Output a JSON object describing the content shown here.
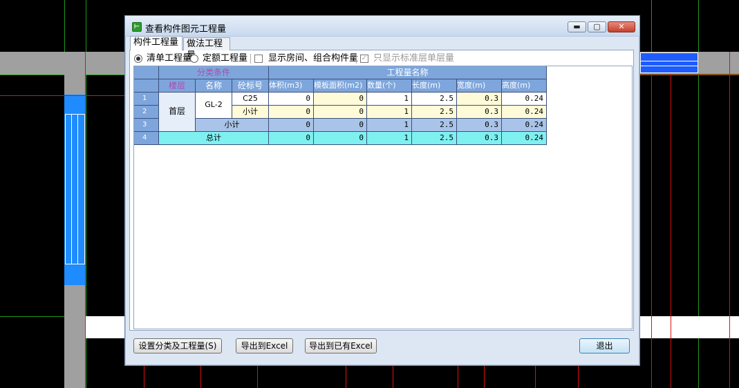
{
  "window": {
    "title": "查看构件图元工程量",
    "minimize_glyph": "▬",
    "maximize_glyph": "▢",
    "close_glyph": "✕"
  },
  "tabs": [
    {
      "label": "构件工程量",
      "active": true
    },
    {
      "label": "做法工程量",
      "active": false
    }
  ],
  "options": {
    "radio_bill": "清单工程量",
    "radio_quota": "定额工程量",
    "check_show_rooms": "显示房间、组合构件量",
    "check_standard_floor": "只显示标准层单层量",
    "check_standard_floor_mark": "✓"
  },
  "table": {
    "group_header_classify": "分类条件",
    "group_header_quantity": "工程量名称",
    "columns": [
      "楼层",
      "名称",
      "砼标号",
      "体积(m3)",
      "模板面积(m2)",
      "数量(个)",
      "长度(m)",
      "宽度(m)",
      "高度(m)"
    ],
    "row_numbers": [
      "1",
      "2",
      "3",
      "4"
    ],
    "floor": "首层",
    "name": "GL-2",
    "rows": [
      {
        "grade": "C25",
        "volume": "0",
        "formwork": "0",
        "count": "1",
        "length": "2.5",
        "width": "0.3",
        "height": "0.24"
      },
      {
        "grade": "小计",
        "volume": "0",
        "formwork": "0",
        "count": "1",
        "length": "2.5",
        "width": "0.3",
        "height": "0.24"
      },
      {
        "label": "小计",
        "volume": "0",
        "formwork": "0",
        "count": "1",
        "length": "2.5",
        "width": "0.3",
        "height": "0.24"
      },
      {
        "label": "总计",
        "volume": "0",
        "formwork": "0",
        "count": "1",
        "length": "2.5",
        "width": "0.3",
        "height": "0.24"
      }
    ]
  },
  "buttons": {
    "set_classify": "设置分类及工程量(S)",
    "export_excel": "导出到Excel",
    "export_existing_excel": "导出到已有Excel",
    "exit": "退出"
  },
  "colors": {
    "header_blue": "#7ea6dc",
    "subtotal_blue": "#a9c4e8",
    "total_cyan": "#7ff0f0",
    "cad_background": "#000000",
    "cad_axis_red": "#dd1111",
    "cad_axis_green": "#1a9a1a"
  }
}
